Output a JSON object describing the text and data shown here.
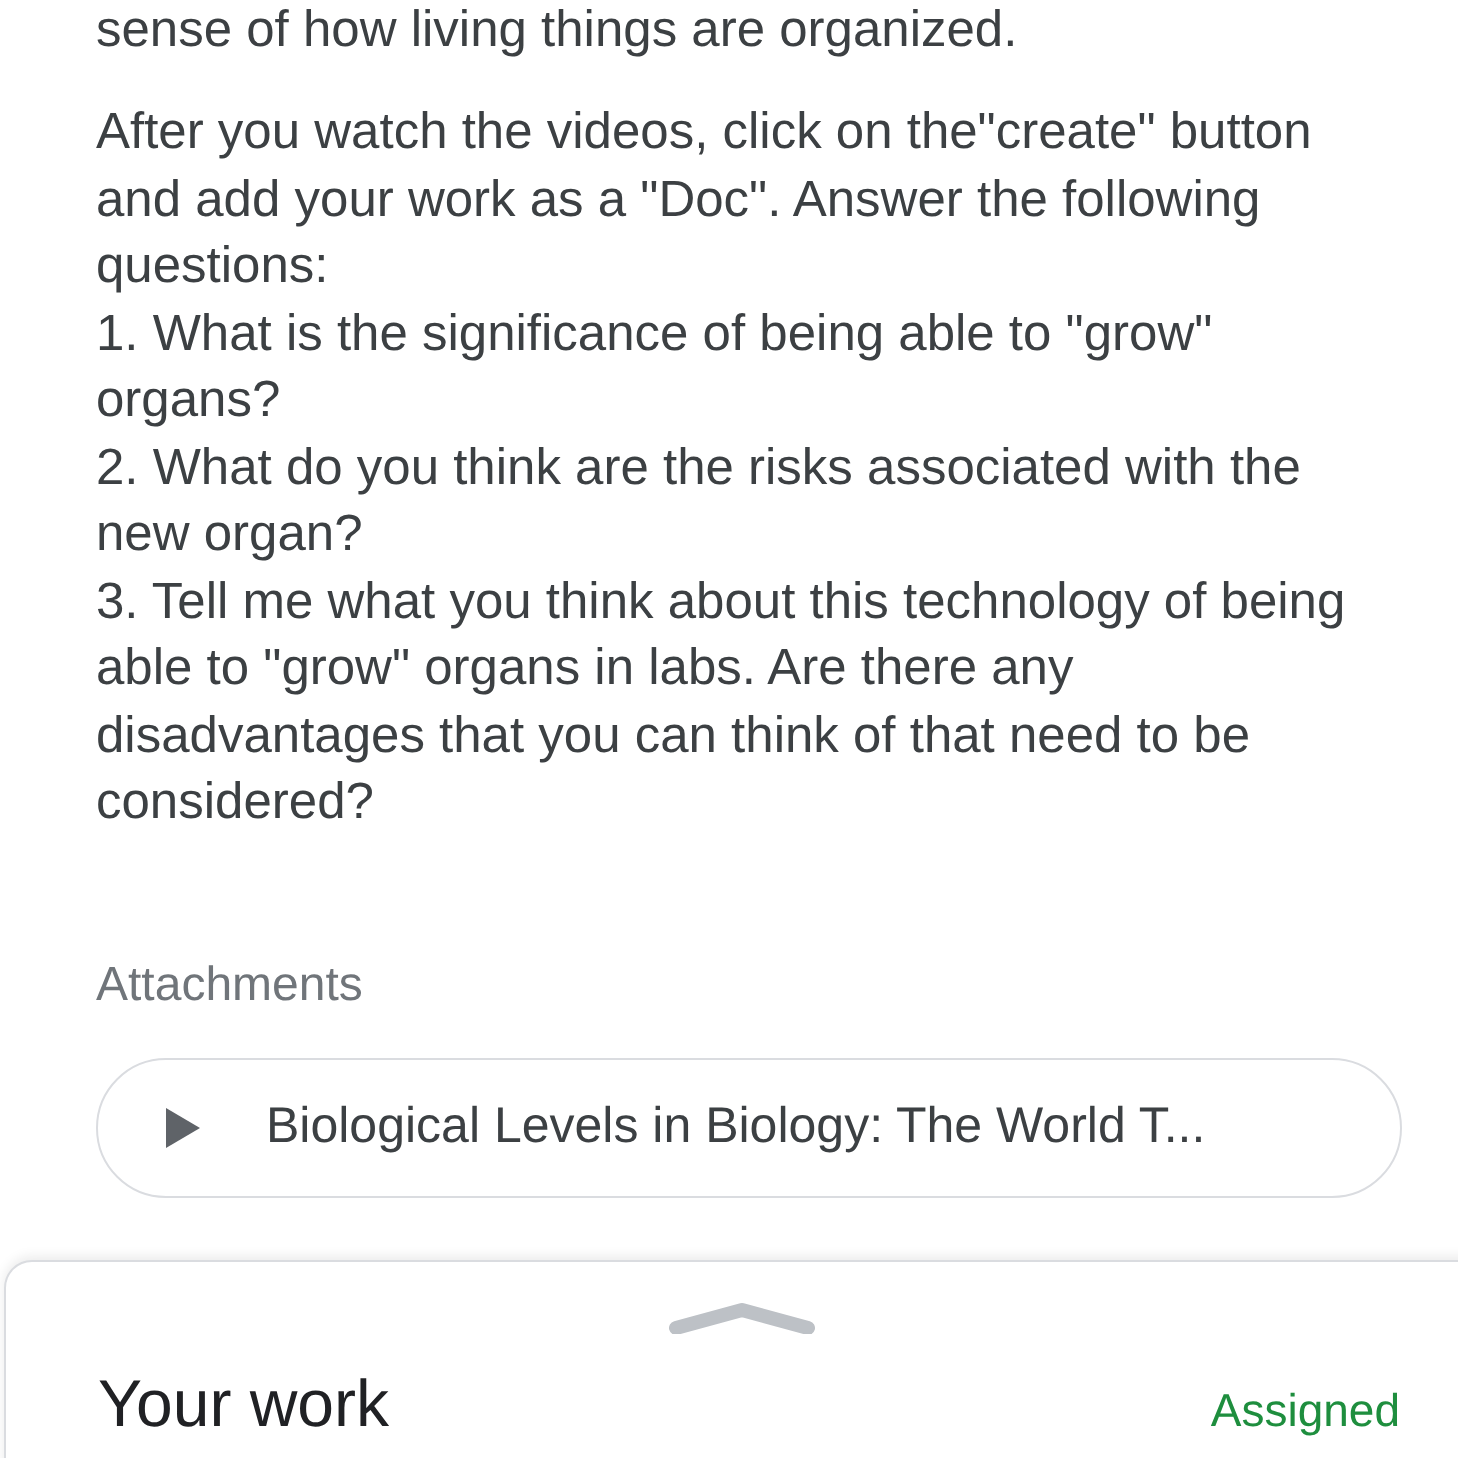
{
  "description": {
    "cut_line": "sense of how living things are organized.",
    "intro": "After you watch the videos, click on the\"create\" button and add your work as a \"Doc\".  Answer the following questions:",
    "questions": [
      "1.  What is the significance of being able to \"grow\" organs?",
      "2.  What do you think are the risks associated with the new organ?",
      "3.  Tell me what you think about this technology of being able to \"grow\" organs in labs.  Are there any disadvantages that you can think of that need to be considered?"
    ]
  },
  "attachments": {
    "heading": "Attachments",
    "items": [
      {
        "title": "Biological Levels in Biology: The World T..."
      }
    ]
  },
  "your_work": {
    "title": "Your work",
    "status": "Assigned"
  }
}
